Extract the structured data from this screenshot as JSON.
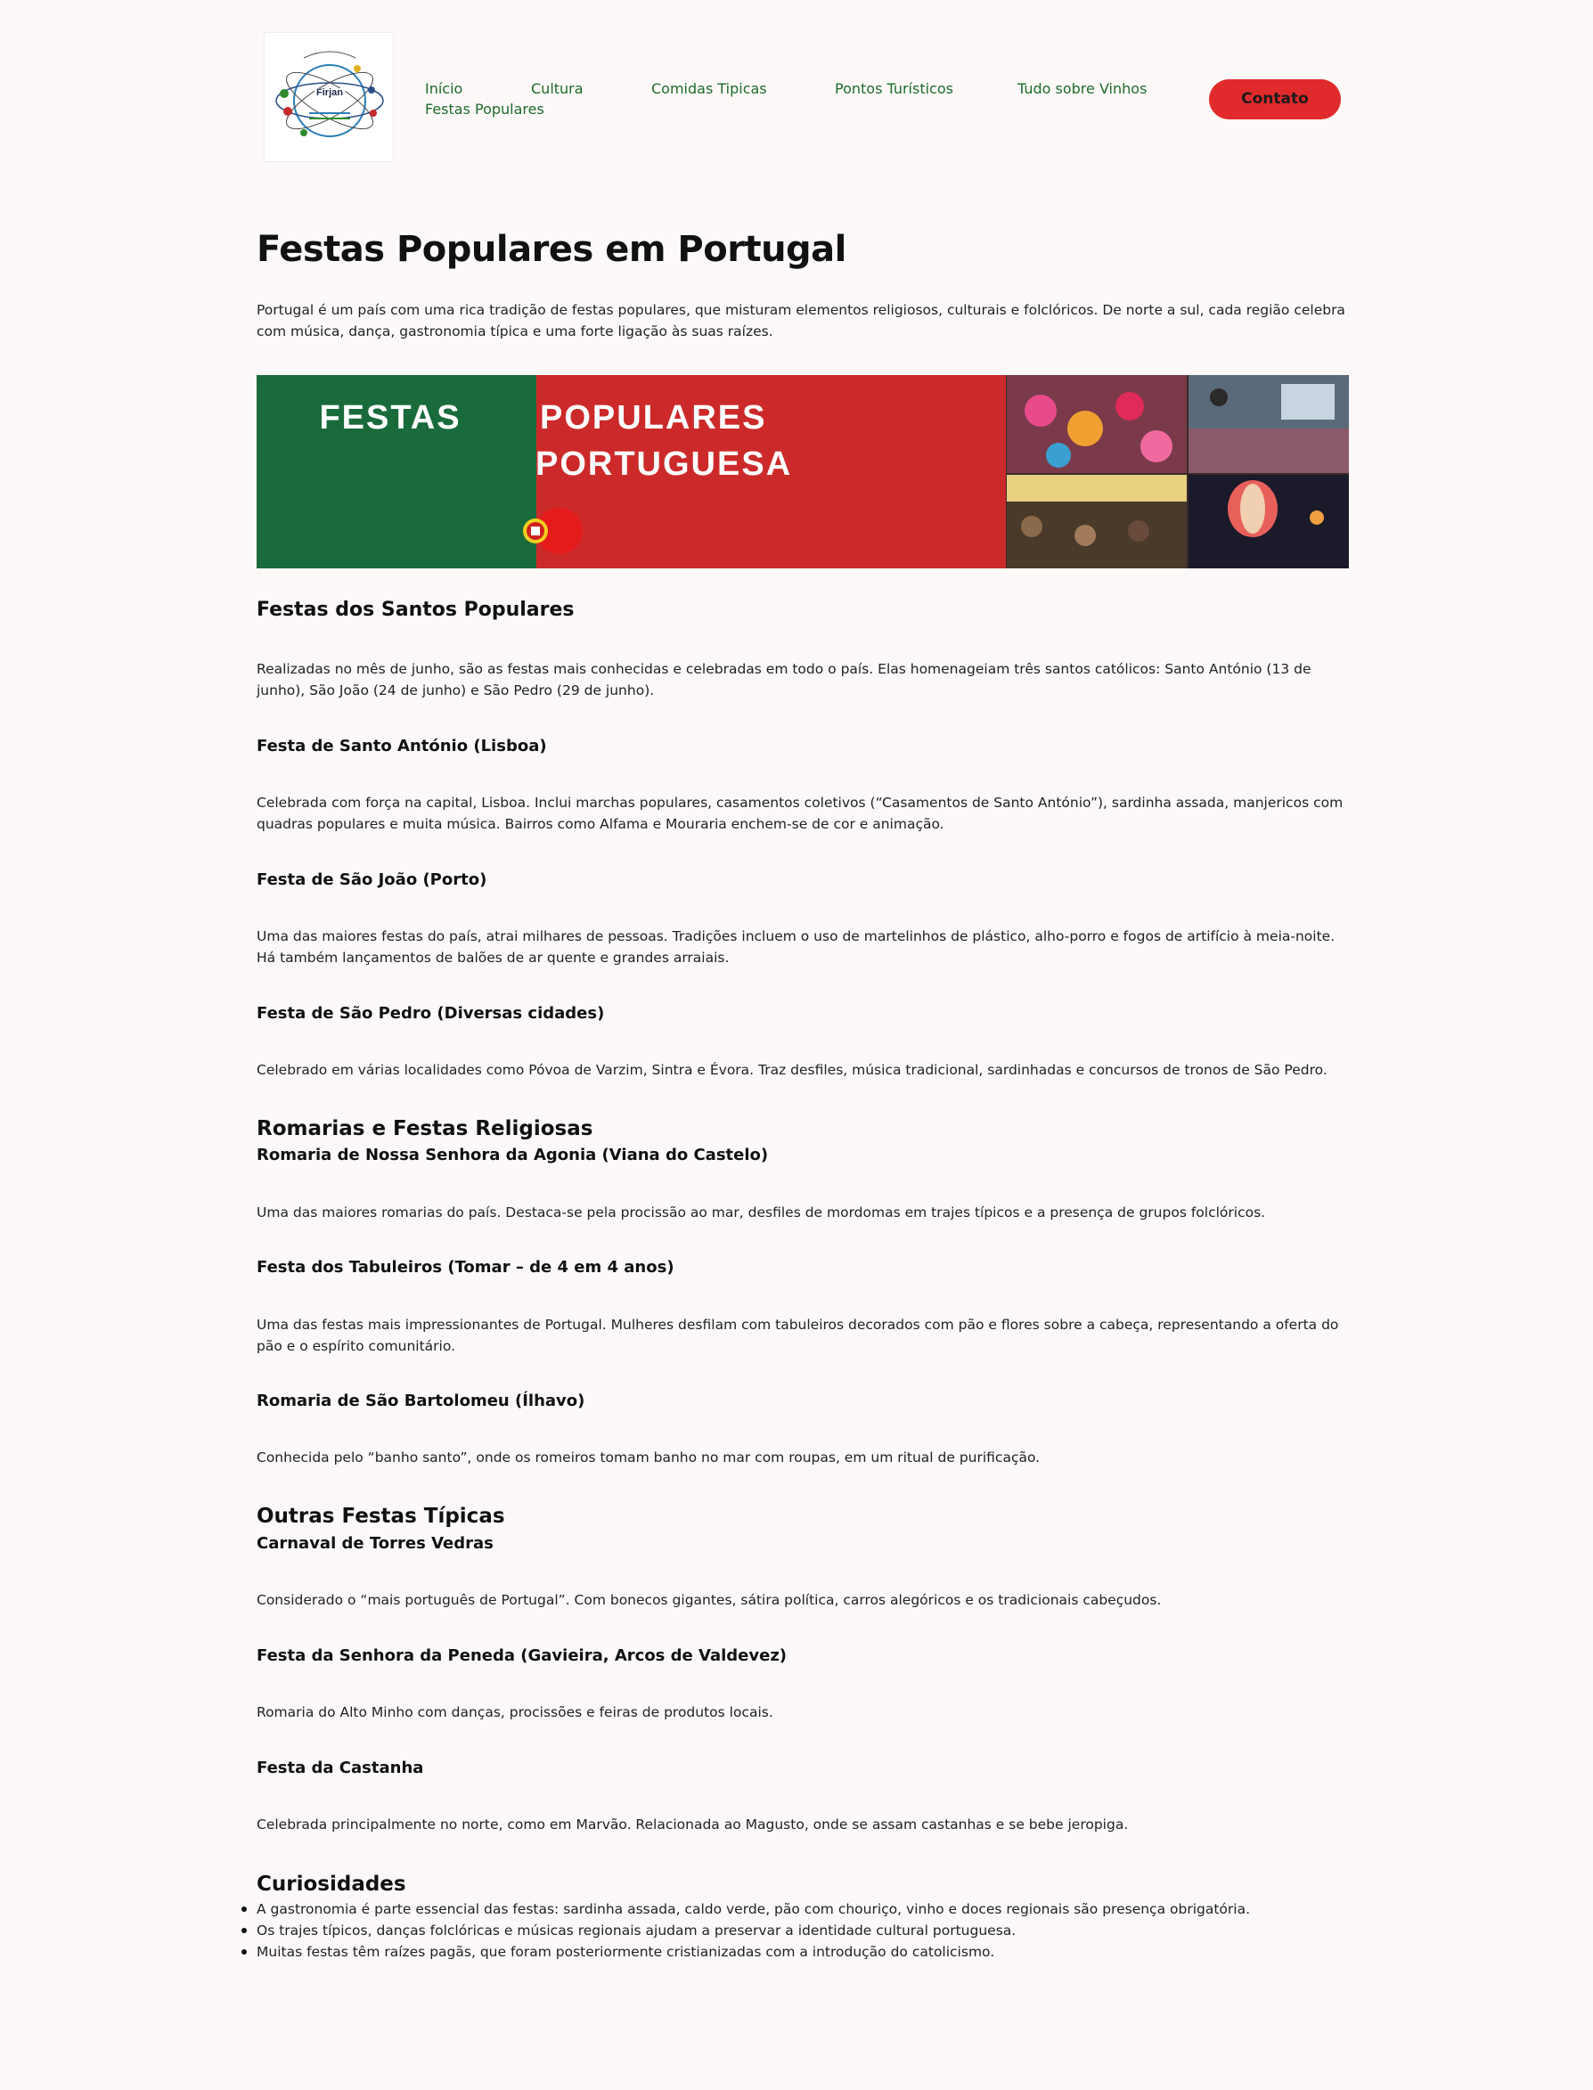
{
  "header": {
    "logo_alt": "Firjan",
    "nav": [
      "Início",
      "Cultura",
      "Comidas Tipicas",
      "Pontos Turísticos",
      "Tudo sobre Vinhos",
      "Festas Populares"
    ],
    "contact_label": "Contato"
  },
  "page": {
    "title": "Festas Populares em Portugal",
    "intro": "Portugal é um país com uma rica tradição de festas populares, que misturam elementos religiosos, culturais e folclóricos. De norte a sul, cada região celebra com música, dança, gastronomia típica e uma forte ligação às suas raízes.",
    "banner": {
      "word1": "FESTAS",
      "word2": "POPULARES",
      "word3": "PORTUGUESA"
    }
  },
  "santos": {
    "heading": "Festas dos Santos Populares",
    "text": "Realizadas no mês de junho, são as festas mais conhecidas e celebradas em todo o país. Elas homenageiam três santos católicos: Santo António (13 de junho), São João (24 de junho) e São Pedro (29 de junho).",
    "items": [
      {
        "title": "Festa de Santo António (Lisboa)",
        "text": "Celebrada com força na capital, Lisboa. Inclui marchas populares, casamentos coletivos (“Casamentos de Santo António”), sardinha assada, manjericos com quadras populares e muita música. Bairros como Alfama e Mouraria enchem-se de cor e animação."
      },
      {
        "title": "Festa de São João (Porto)",
        "text": "Uma das maiores festas do país, atrai milhares de pessoas. Tradições incluem o uso de martelinhos de plástico, alho-porro e fogos de artifício à meia-noite. Há também lançamentos de balões de ar quente e grandes arraiais."
      },
      {
        "title": "Festa de São Pedro (Diversas cidades)",
        "text": "Celebrado em várias localidades como Póvoa de Varzim, Sintra e Évora. Traz desfiles, música tradicional, sardinhadas e concursos de tronos de São Pedro."
      }
    ]
  },
  "romarias": {
    "heading": "Romarias e Festas Religiosas",
    "items": [
      {
        "title": "Romaria de Nossa Senhora da Agonia (Viana do Castelo)",
        "text": "Uma das maiores romarias do país. Destaca-se pela procissão ao mar, desfiles de mordomas em trajes típicos e a presença de grupos folclóricos."
      },
      {
        "title": "Festa dos Tabuleiros (Tomar – de 4 em 4 anos)",
        "text": "Uma das festas mais impressionantes de Portugal. Mulheres desfilam com tabuleiros decorados com pão e flores sobre a cabeça, representando a oferta do pão e o espírito comunitário."
      },
      {
        "title": "Romaria de São Bartolomeu (Ílhavo)",
        "text": "Conhecida pelo “banho santo”, onde os romeiros tomam banho no mar com roupas, em um ritual de purificação."
      }
    ]
  },
  "outras": {
    "heading": "Outras Festas Típicas",
    "items": [
      {
        "title": "Carnaval de Torres Vedras",
        "text": "Considerado o “mais português de Portugal”. Com bonecos gigantes, sátira política, carros alegóricos e os tradicionais cabeçudos."
      },
      {
        "title": "Festa da Senhora da Peneda (Gavieira, Arcos de Valdevez)",
        "text": "Romaria do Alto Minho com danças, procissões e feiras de produtos locais."
      },
      {
        "title": "Festa da Castanha",
        "text": "Celebrada principalmente no norte, como em Marvão. Relacionada ao Magusto, onde se assam castanhas e se bebe jeropiga."
      }
    ]
  },
  "curiosidades": {
    "heading": "Curiosidades",
    "items": [
      "A gastronomia é parte essencial das festas: sardinha assada, caldo verde, pão com chouriço, vinho e doces regionais são presença obrigatória.",
      "Os trajes típicos, danças folclóricas e músicas regionais ajudam a preservar a identidade cultural portuguesa.",
      "Muitas festas têm raízes pagãs, que foram posteriormente cristianizadas com a introdução do catolicismo."
    ]
  },
  "colors": {
    "accent_green": "#1e6a2c",
    "button_red": "#e12a2c",
    "banner_green": "#1a6b3c",
    "banner_red": "#cc2a2a",
    "background": "#fcf9f8"
  }
}
